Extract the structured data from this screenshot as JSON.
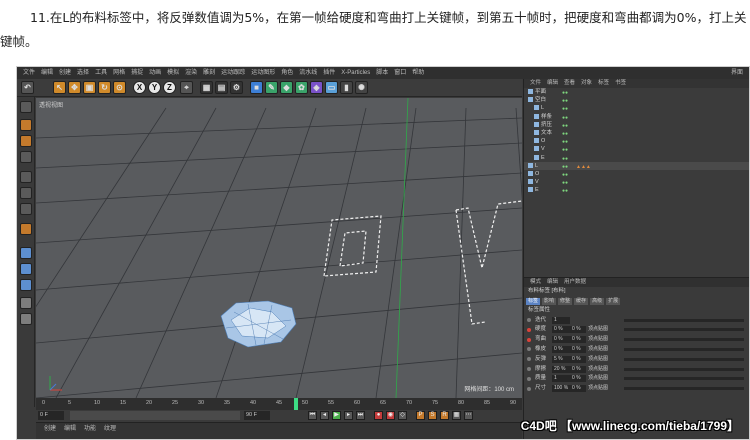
{
  "article": {
    "step_text": "11.在L的布料标签中，将反弹数值调为5%，在第一帧给硬度和弯曲打上关键帧，到第五十帧时，把硬度和弯曲都调为0%，打上关键帧。"
  },
  "menubar": {
    "items": [
      "文件",
      "编辑",
      "创建",
      "选择",
      "工具",
      "网格",
      "捕捉",
      "动画",
      "模拟",
      "渲染",
      "雕刻",
      "运动跟踪",
      "运动图形",
      "角色",
      "流水线",
      "插件",
      "X-Particles",
      "脚本",
      "窗口",
      "帮助"
    ],
    "right_label": "界面"
  },
  "toolbar": {
    "axis_x": "X",
    "axis_y": "Y",
    "axis_z": "Z"
  },
  "viewport": {
    "label": "透视视图",
    "stat": "网格间距：100 cm"
  },
  "timeline": {
    "ticks": [
      "0",
      "5",
      "10",
      "15",
      "20",
      "25",
      "30",
      "35",
      "40",
      "45",
      "50",
      "55",
      "60",
      "65",
      "70",
      "75",
      "80",
      "85",
      "90"
    ],
    "current_frame": "50 F",
    "start_field": "0 F",
    "end_field": "90 F"
  },
  "bottom_tabs": [
    "创建",
    "编辑",
    "功能",
    "纹理"
  ],
  "objects": {
    "menu": [
      "文件",
      "编辑",
      "查看",
      "对象",
      "标签",
      "书签"
    ],
    "rows": [
      {
        "name": "平面",
        "selected": false
      },
      {
        "name": "空白",
        "selected": false
      },
      {
        "name": "L",
        "selected": false
      },
      {
        "name": "样条",
        "selected": false
      },
      {
        "name": "挤压",
        "selected": false
      },
      {
        "name": "文本",
        "selected": false
      },
      {
        "name": "O",
        "selected": false
      },
      {
        "name": "V",
        "selected": false
      },
      {
        "name": "E",
        "selected": false
      },
      {
        "name": "L",
        "selected": true
      },
      {
        "name": "O",
        "selected": false
      },
      {
        "name": "V",
        "selected": false
      },
      {
        "name": "E",
        "selected": false
      }
    ]
  },
  "attributes": {
    "tabs": [
      "模式",
      "编辑",
      "用户数据"
    ],
    "title": "布料标签 [布料]",
    "subtabs": [
      "标签",
      "影响",
      "修整",
      "缓存",
      "高级",
      "扩展"
    ],
    "section": "标签属性",
    "rows": [
      {
        "name": "迭代",
        "value": "1",
        "field": "",
        "unit": "",
        "keyed": false
      },
      {
        "name": "硬度",
        "value": "0 %",
        "field": "0 %",
        "unit": "顶点贴图",
        "keyed": true
      },
      {
        "name": "弯曲",
        "value": "0 %",
        "field": "0 %",
        "unit": "顶点贴图",
        "keyed": true
      },
      {
        "name": "橡皮",
        "value": "0 %",
        "field": "0 %",
        "unit": "顶点贴图",
        "keyed": false
      },
      {
        "name": "反弹",
        "value": "5 %",
        "field": "0 %",
        "unit": "顶点贴图",
        "keyed": false
      },
      {
        "name": "摩擦",
        "value": "20 %",
        "field": "0 %",
        "unit": "顶点贴图",
        "keyed": false
      },
      {
        "name": "质量",
        "value": "1",
        "field": "0 %",
        "unit": "顶点贴图",
        "keyed": false
      },
      {
        "name": "尺寸",
        "value": "100 %",
        "field": "0 %",
        "unit": "顶点贴图",
        "keyed": false
      }
    ]
  },
  "watermark": "C4D吧 【www.linecg.com/tieba/1799】"
}
